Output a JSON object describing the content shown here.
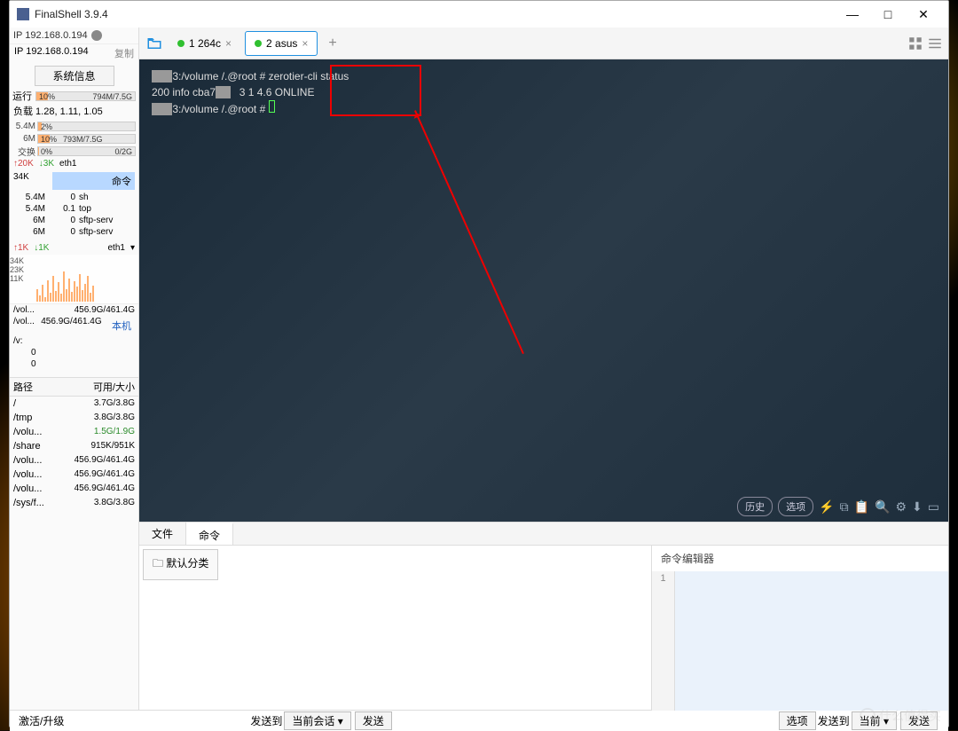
{
  "titlebar": {
    "title": "FinalShell 3.9.4"
  },
  "sidebar": {
    "ip_display": "IP 192.168.0.194",
    "ip_full": "IP 192.168.0.194",
    "copy": "复制",
    "sysinfo_btn": "系统信息",
    "runtime_label": "运行",
    "runtime_pct": "10%",
    "runtime_mem": "794M/7.5G",
    "load_label": "负载 1.28, 1.11, 1.05",
    "bars": [
      {
        "label": "5.4M",
        "left": "2%",
        "right": "",
        "fill": 4
      },
      {
        "label": "6M",
        "left": "10%",
        "mid": "793M/7.5G",
        "right": "",
        "fill": 12
      },
      {
        "label": "交换",
        "left": "0%",
        "right": "0/2G",
        "fill": 1
      }
    ],
    "net1": {
      "up": "↑20K",
      "down": "↓3K",
      "if": "eth1"
    },
    "net1b": {
      "label": "34K"
    },
    "cmd_header": "命令",
    "procs": [
      {
        "mem": "5.4M",
        "cpu": "0",
        "name": "sh"
      },
      {
        "mem": "5.4M",
        "cpu": "0.1",
        "name": "top"
      },
      {
        "mem": "6M",
        "cpu": "0",
        "name": "sftp-serv"
      },
      {
        "mem": "6M",
        "cpu": "0",
        "name": "sftp-serv"
      }
    ],
    "net2": {
      "up": "↑1K",
      "down": "↓1K",
      "if": "eth1"
    },
    "chart_labels": [
      "34K",
      "23K",
      "11K"
    ],
    "vols": [
      {
        "path": "/vol...",
        "size": "456.9G/461.4G"
      },
      {
        "path": "/vol...",
        "size": "456.9G/461.4G"
      }
    ],
    "vs_row": "/v:",
    "zeros": [
      "0",
      "0"
    ],
    "local": "本机",
    "path_hdr": {
      "col1": "路径",
      "col2": "可用/大小"
    },
    "paths": [
      {
        "p": "/",
        "s": "3.7G/3.8G"
      },
      {
        "p": "/tmp",
        "s": "3.8G/3.8G"
      },
      {
        "p": "/volu...",
        "s": "1.5G/1.9G",
        "hl": true
      },
      {
        "p": "/share",
        "s": "915K/951K"
      },
      {
        "p": "/volu...",
        "s": "456.9G/461.4G"
      },
      {
        "p": "/volu...",
        "s": "456.9G/461.4G"
      },
      {
        "p": "/volu...",
        "s": "456.9G/461.4G"
      },
      {
        "p": "/sys/f...",
        "s": "3.8G/3.8G"
      }
    ]
  },
  "tabs": [
    {
      "label": "1 264c",
      "active": false
    },
    {
      "label": "2 asus",
      "active": true
    }
  ],
  "terminal": {
    "line1_a": "       ",
    "line1_b": "3:/volume /.@root # zerotier-cli status",
    "line2_a": "200 info cba7",
    "line2_b": "   3 1 4.6 ONLINE",
    "line3_a": "       ",
    "line3_b": "3:/volume /.@root # "
  },
  "term_footer": {
    "history": "历史",
    "options": "选项"
  },
  "bottom_tabs": {
    "files": "文件",
    "commands": "命令"
  },
  "bottom_panel": {
    "folder": "默认分类",
    "editor_title": "命令编辑器",
    "line_no": "1"
  },
  "statusbar": {
    "activate": "激活/升级",
    "send_to": "发送到",
    "current_session": "当前会话",
    "send": "发送",
    "options": "选项",
    "send_to2": "发送到",
    "current2": "当前",
    "send2": "发送"
  },
  "watermark": "什么值得买"
}
